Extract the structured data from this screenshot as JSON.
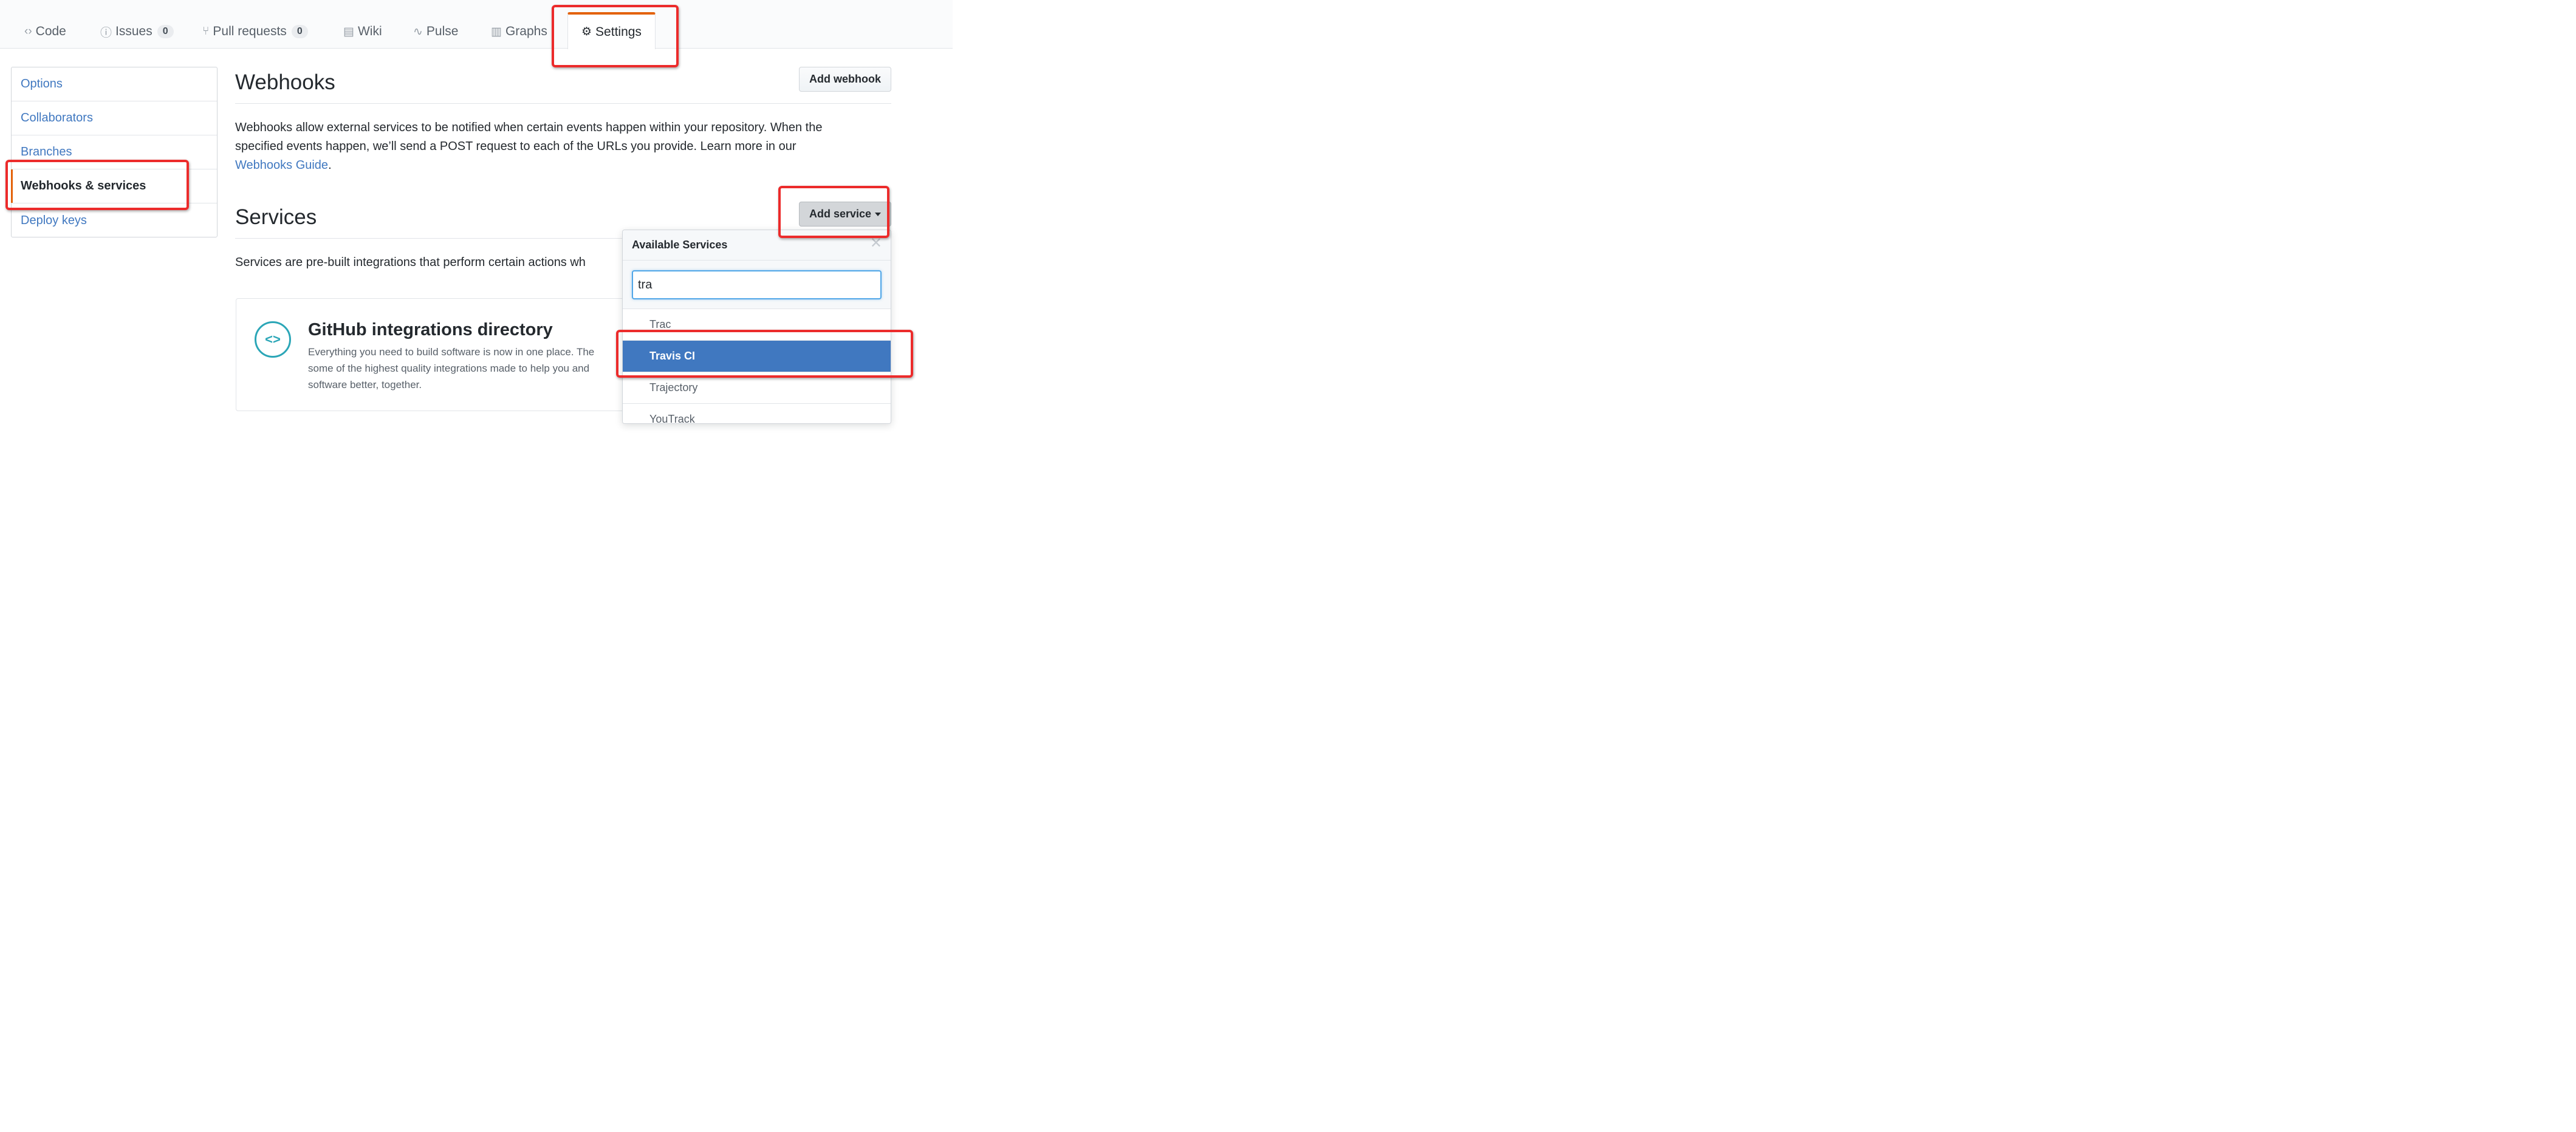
{
  "tabs": [
    {
      "label": "Code",
      "icon": "code-icon",
      "glyph": "‹›"
    },
    {
      "label": "Issues",
      "icon": "issue-icon",
      "glyph": "ⓘ",
      "count": "0"
    },
    {
      "label": "Pull requests",
      "icon": "pull-request-icon",
      "glyph": "⑂",
      "count": "0"
    },
    {
      "label": "Wiki",
      "icon": "book-icon",
      "glyph": "▤"
    },
    {
      "label": "Pulse",
      "icon": "pulse-icon",
      "glyph": "∿"
    },
    {
      "label": "Graphs",
      "icon": "graph-icon",
      "glyph": "▥"
    },
    {
      "label": "Settings",
      "icon": "gear-icon",
      "glyph": "⚙",
      "selected": true
    }
  ],
  "sidebar": {
    "items": [
      {
        "label": "Options"
      },
      {
        "label": "Collaborators"
      },
      {
        "label": "Branches"
      },
      {
        "label": "Webhooks & services",
        "selected": true
      },
      {
        "label": "Deploy keys"
      }
    ]
  },
  "webhooks": {
    "title": "Webhooks",
    "add_button": "Add webhook",
    "description_1": "Webhooks allow external services to be notified when certain events happen within your repository. When the",
    "description_2": "specified events happen, we’ll send a POST request to each of the URLs you provide. Learn more in our",
    "guide_link": "Webhooks Guide",
    "guide_suffix": "."
  },
  "services": {
    "title": "Services",
    "add_button": "Add service",
    "description": "Services are pre-built integrations that perform certain actions wh"
  },
  "integrations_card": {
    "icon": "code-icon",
    "glyph": "<>",
    "title": "GitHub integrations directory",
    "desc_1": "Everything you need to build software is now in one place. The",
    "desc_2": "some of the highest quality integrations made to help you and",
    "desc_3": "software better, together."
  },
  "dropdown": {
    "title": "Available Services",
    "close_glyph": "✕",
    "filter_value": "tra",
    "items": [
      {
        "label": "Trac"
      },
      {
        "label": "Travis CI",
        "active": true
      },
      {
        "label": "Trajectory"
      },
      {
        "label": "YouTrack"
      }
    ]
  },
  "colors": {
    "accent": "#e36209",
    "link": "#4078c0",
    "selected_item": "#4078c0",
    "annotation": "#ec2b2b",
    "integration_icon": "#2ba6b7"
  }
}
